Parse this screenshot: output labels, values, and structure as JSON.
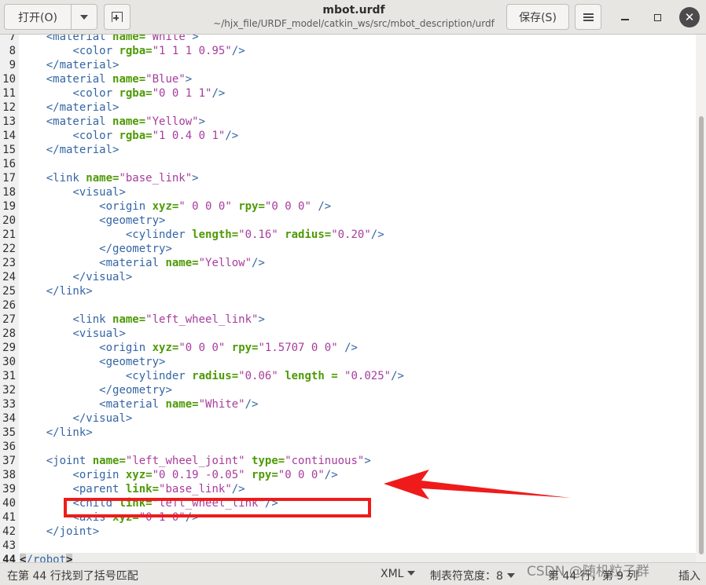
{
  "header": {
    "open_label": "打开(O)",
    "save_label": "保存(S)",
    "title": "mbot.urdf",
    "subtitle": "~/hjx_file/URDF_model/catkin_ws/src/mbot_description/urdf"
  },
  "editor": {
    "lines": [
      {
        "n": "7",
        "tokens": [
          [
            "p",
            "    "
          ],
          [
            "t",
            "<material "
          ],
          [
            "a",
            "name="
          ],
          [
            "v",
            "\"White\""
          ],
          [
            "t",
            ">"
          ]
        ]
      },
      {
        "n": "8",
        "tokens": [
          [
            "p",
            "        "
          ],
          [
            "t",
            "<color "
          ],
          [
            "a",
            "rgba="
          ],
          [
            "v",
            "\"1 1 1 0.95\""
          ],
          [
            "t",
            "/>"
          ]
        ]
      },
      {
        "n": "9",
        "tokens": [
          [
            "p",
            "    "
          ],
          [
            "t",
            "</material>"
          ]
        ]
      },
      {
        "n": "10",
        "tokens": [
          [
            "p",
            "    "
          ],
          [
            "t",
            "<material "
          ],
          [
            "a",
            "name="
          ],
          [
            "v",
            "\"Blue\""
          ],
          [
            "t",
            ">"
          ]
        ]
      },
      {
        "n": "11",
        "tokens": [
          [
            "p",
            "        "
          ],
          [
            "t",
            "<color "
          ],
          [
            "a",
            "rgba="
          ],
          [
            "v",
            "\"0 0 1 1\""
          ],
          [
            "t",
            "/>"
          ]
        ]
      },
      {
        "n": "12",
        "tokens": [
          [
            "p",
            "    "
          ],
          [
            "t",
            "</material>"
          ]
        ]
      },
      {
        "n": "13",
        "tokens": [
          [
            "p",
            "    "
          ],
          [
            "t",
            "<material "
          ],
          [
            "a",
            "name="
          ],
          [
            "v",
            "\"Yellow\""
          ],
          [
            "t",
            ">"
          ]
        ]
      },
      {
        "n": "14",
        "tokens": [
          [
            "p",
            "        "
          ],
          [
            "t",
            "<color "
          ],
          [
            "a",
            "rgba="
          ],
          [
            "v",
            "\"1 0.4 0 1\""
          ],
          [
            "t",
            "/>"
          ]
        ]
      },
      {
        "n": "15",
        "tokens": [
          [
            "p",
            "    "
          ],
          [
            "t",
            "</material>"
          ]
        ]
      },
      {
        "n": "16",
        "tokens": []
      },
      {
        "n": "17",
        "tokens": [
          [
            "p",
            "    "
          ],
          [
            "t",
            "<link "
          ],
          [
            "a",
            "name="
          ],
          [
            "v",
            "\"base_link\""
          ],
          [
            "t",
            ">"
          ]
        ]
      },
      {
        "n": "18",
        "tokens": [
          [
            "p",
            "        "
          ],
          [
            "t",
            "<visual>"
          ]
        ]
      },
      {
        "n": "19",
        "tokens": [
          [
            "p",
            "            "
          ],
          [
            "t",
            "<origin "
          ],
          [
            "a",
            "xyz="
          ],
          [
            "v",
            "\" 0 0 0\""
          ],
          [
            "p",
            " "
          ],
          [
            "a",
            "rpy="
          ],
          [
            "v",
            "\"0 0 0\""
          ],
          [
            "p",
            " "
          ],
          [
            "t",
            "/>"
          ]
        ]
      },
      {
        "n": "20",
        "tokens": [
          [
            "p",
            "            "
          ],
          [
            "t",
            "<geometry>"
          ]
        ]
      },
      {
        "n": "21",
        "tokens": [
          [
            "p",
            "                "
          ],
          [
            "t",
            "<cylinder "
          ],
          [
            "a",
            "length="
          ],
          [
            "v",
            "\"0.16\""
          ],
          [
            "p",
            " "
          ],
          [
            "a",
            "radius="
          ],
          [
            "v",
            "\"0.20\""
          ],
          [
            "t",
            "/>"
          ]
        ]
      },
      {
        "n": "22",
        "tokens": [
          [
            "p",
            "            "
          ],
          [
            "t",
            "</geometry>"
          ]
        ]
      },
      {
        "n": "23",
        "tokens": [
          [
            "p",
            "            "
          ],
          [
            "t",
            "<material "
          ],
          [
            "a",
            "name="
          ],
          [
            "v",
            "\"Yellow\""
          ],
          [
            "t",
            "/>"
          ]
        ]
      },
      {
        "n": "24",
        "tokens": [
          [
            "p",
            "        "
          ],
          [
            "t",
            "</visual>"
          ]
        ]
      },
      {
        "n": "25",
        "tokens": [
          [
            "p",
            "    "
          ],
          [
            "t",
            "</link>"
          ]
        ]
      },
      {
        "n": "26",
        "tokens": []
      },
      {
        "n": "27",
        "tokens": [
          [
            "p",
            "        "
          ],
          [
            "t",
            "<link "
          ],
          [
            "a",
            "name="
          ],
          [
            "v",
            "\"left_wheel_link\""
          ],
          [
            "t",
            ">"
          ]
        ]
      },
      {
        "n": "28",
        "tokens": [
          [
            "p",
            "        "
          ],
          [
            "t",
            "<visual>"
          ]
        ]
      },
      {
        "n": "29",
        "tokens": [
          [
            "p",
            "            "
          ],
          [
            "t",
            "<origin "
          ],
          [
            "a",
            "xyz="
          ],
          [
            "v",
            "\"0 0 0\""
          ],
          [
            "p",
            " "
          ],
          [
            "a",
            "rpy="
          ],
          [
            "v",
            "\"1.5707 0 0\""
          ],
          [
            "p",
            " "
          ],
          [
            "t",
            "/>"
          ]
        ]
      },
      {
        "n": "30",
        "tokens": [
          [
            "p",
            "            "
          ],
          [
            "t",
            "<geometry>"
          ]
        ]
      },
      {
        "n": "31",
        "tokens": [
          [
            "p",
            "                "
          ],
          [
            "t",
            "<cylinder "
          ],
          [
            "a",
            "radius="
          ],
          [
            "v",
            "\"0.06\""
          ],
          [
            "p",
            " "
          ],
          [
            "a",
            "length = "
          ],
          [
            "v",
            "\"0.025\""
          ],
          [
            "t",
            "/>"
          ]
        ]
      },
      {
        "n": "32",
        "tokens": [
          [
            "p",
            "            "
          ],
          [
            "t",
            "</geometry>"
          ]
        ]
      },
      {
        "n": "33",
        "tokens": [
          [
            "p",
            "            "
          ],
          [
            "t",
            "<material "
          ],
          [
            "a",
            "name="
          ],
          [
            "v",
            "\"White\""
          ],
          [
            "t",
            "/>"
          ]
        ]
      },
      {
        "n": "34",
        "tokens": [
          [
            "p",
            "        "
          ],
          [
            "t",
            "</visual>"
          ]
        ]
      },
      {
        "n": "35",
        "tokens": [
          [
            "p",
            "    "
          ],
          [
            "t",
            "</link>"
          ]
        ]
      },
      {
        "n": "36",
        "tokens": []
      },
      {
        "n": "37",
        "tokens": [
          [
            "p",
            "    "
          ],
          [
            "t",
            "<joint "
          ],
          [
            "a",
            "name="
          ],
          [
            "v",
            "\"left_wheel_joint\""
          ],
          [
            "p",
            " "
          ],
          [
            "a",
            "type="
          ],
          [
            "v",
            "\"continuous\""
          ],
          [
            "t",
            ">"
          ]
        ]
      },
      {
        "n": "38",
        "tokens": [
          [
            "p",
            "        "
          ],
          [
            "t",
            "<origin "
          ],
          [
            "a",
            "xyz="
          ],
          [
            "v",
            "\"0 0.19 -0.05\""
          ],
          [
            "p",
            " "
          ],
          [
            "a",
            "rpy="
          ],
          [
            "v",
            "\"0 0 0\""
          ],
          [
            "t",
            "/>"
          ]
        ]
      },
      {
        "n": "39",
        "tokens": [
          [
            "p",
            "        "
          ],
          [
            "t",
            "<parent "
          ],
          [
            "a",
            "link="
          ],
          [
            "v",
            "\"base_link\""
          ],
          [
            "t",
            "/>"
          ]
        ]
      },
      {
        "n": "40",
        "tokens": [
          [
            "p",
            "        "
          ],
          [
            "t",
            "<child "
          ],
          [
            "a",
            "link="
          ],
          [
            "v",
            "\"left_wheel_link\""
          ],
          [
            "t",
            "/>"
          ]
        ]
      },
      {
        "n": "41",
        "tokens": [
          [
            "p",
            "        "
          ],
          [
            "t",
            "<axis "
          ],
          [
            "a",
            "xyz="
          ],
          [
            "v",
            "\"0 1 0\""
          ],
          [
            "t",
            "/>"
          ]
        ]
      },
      {
        "n": "42",
        "tokens": [
          [
            "p",
            "    "
          ],
          [
            "t",
            "</joint>"
          ]
        ]
      },
      {
        "n": "43",
        "tokens": []
      },
      {
        "n": "44",
        "current": true,
        "tokens": [
          [
            "bm",
            "<"
          ],
          [
            "t",
            "/robot"
          ],
          [
            "bm",
            ">"
          ]
        ]
      }
    ]
  },
  "status": {
    "message": "在第 44 行找到了括号匹配",
    "language": "XML",
    "tab_width": "制表符宽度：8",
    "position": "第 44 行，第 9 列",
    "mode": "插入"
  },
  "watermark": "CSDN @随机粒子群",
  "colors": {
    "tag": "#3465a4",
    "attribute": "#4e9a06",
    "value": "#a73c9c",
    "annotation": "#ef1b1b"
  }
}
